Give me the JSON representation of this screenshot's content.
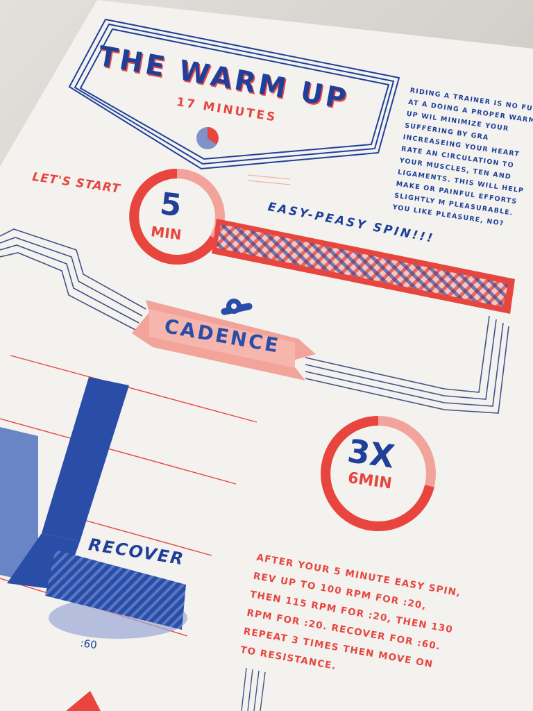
{
  "poster": {
    "title": "THE WARM UP",
    "subtitle": "17 MINUTES",
    "intro": "RIDING A TRAINER IS NO FUN AT A DOING A PROPER WARM UP WIL MINIMIZE YOUR SUFFERING BY GRA INCREASEING YOUR HEART RATE AN CIRCULATION TO YOUR MUSCLES, TEN AND LIGAMENTS. THIS WILL HELP MAKE OR PAINFUL EFFORTS SLIGHTLY M PLEASURABLE. YOU LIKE PLEASURE, NO?",
    "lets_start": "LET'S START",
    "step1": {
      "value": "5",
      "unit": "MIN",
      "label": "EASY-PEASY SPIN!!!"
    },
    "cadence": "CADENCE",
    "step2": {
      "value": "3X",
      "unit": "6MIN"
    },
    "recover": "RECOVER",
    "recover_time": ":60",
    "instructions": "AFTER YOUR 5 MINUTE EASY SPIN, REV UP TO 100 RPM FOR :20, THEN 115 RPM FOR :20, THEN 130 RPM FOR :20. RECOVER FOR :60. REPEAT 3 TIMES THEN MOVE ON TO RESISTANCE."
  },
  "colors": {
    "blue": "#1f3f99",
    "red": "#e8453f",
    "pink": "#f2a39a",
    "paper": "#f3f2ee"
  }
}
